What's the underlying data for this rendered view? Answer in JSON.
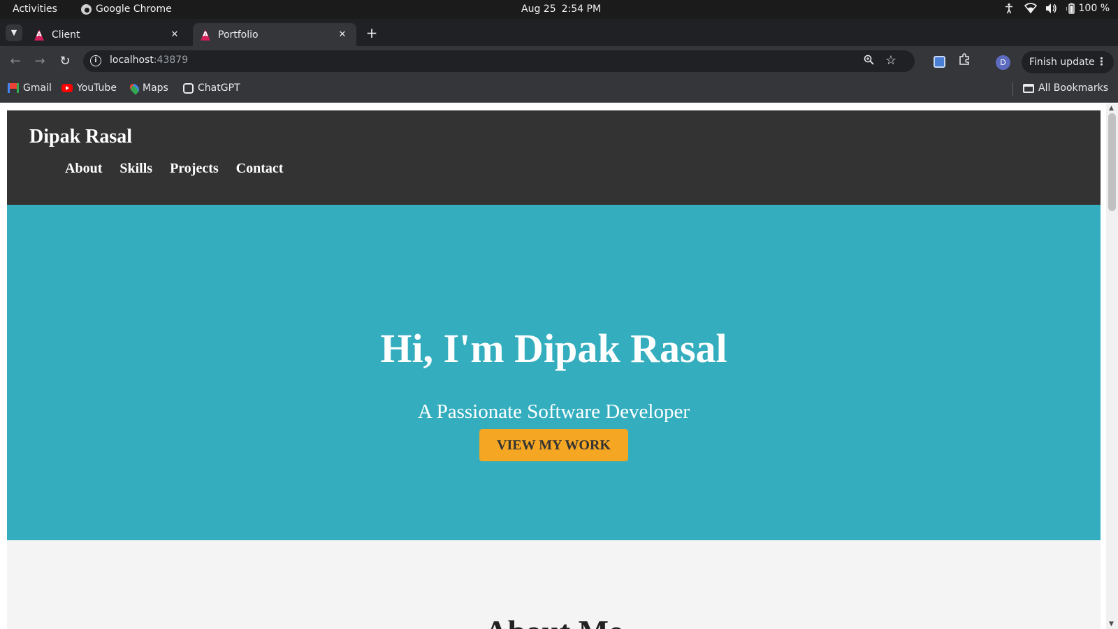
{
  "system_bar": {
    "activities": "Activities",
    "app_name": "Google Chrome",
    "date": "Aug 25",
    "time": "2:54 PM",
    "battery": "100 %"
  },
  "browser": {
    "tabs": [
      {
        "title": "Client",
        "active": false
      },
      {
        "title": "Portfolio",
        "active": true
      }
    ],
    "url_host": "localhost",
    "url_port": ":43879",
    "profile_initial": "D",
    "finish_update": "Finish update",
    "bookmarks": [
      {
        "label": "Gmail",
        "icon": "gmail-icon"
      },
      {
        "label": "YouTube",
        "icon": "youtube-icon"
      },
      {
        "label": "Maps",
        "icon": "maps-icon"
      },
      {
        "label": "ChatGPT",
        "icon": "chatgpt-icon"
      }
    ],
    "all_bookmarks": "All Bookmarks"
  },
  "site": {
    "logo": "Dipak Rasal",
    "nav": [
      "About",
      "Skills",
      "Projects",
      "Contact"
    ],
    "hero": {
      "title": "Hi, I'm Dipak Rasal",
      "subtitle": "A Passionate Software Developer",
      "cta": "VIEW MY WORK"
    },
    "about_heading": "About Me"
  },
  "colors": {
    "header_bg": "#333333",
    "hero_bg": "#34aebf",
    "cta_bg": "#f5a623",
    "about_bg": "#f4f4f4"
  }
}
